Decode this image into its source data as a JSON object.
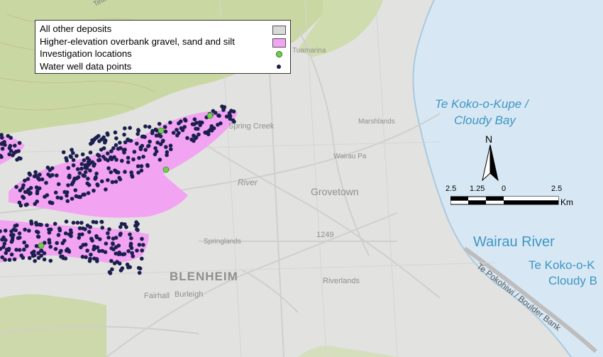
{
  "legend": {
    "items": [
      {
        "label": "All other deposits",
        "symbol": "grey-box",
        "color": "#d9d9d9"
      },
      {
        "label": "Higher-elevation overbank gravel, sand and silt",
        "symbol": "pink-box",
        "color": "#f2a3f2"
      },
      {
        "label": "Investigation locations",
        "symbol": "green-dot",
        "color": "#6fd14a"
      },
      {
        "label": "Water well data points",
        "symbol": "navy-dot",
        "color": "#1a1f4d"
      }
    ]
  },
  "map_labels": {
    "bay_name_line1": "Te Koko-o-Kupe /",
    "bay_name_line2": "Cloudy Bay",
    "river": "Wairau River",
    "bay_repeat_line1": "Te Koko-o-K",
    "bay_repeat_line2": "Cloudy B",
    "boulder_bank": "Te Pokohiwi / Boulder Bank",
    "town_main": "BLENHEIM",
    "grovetown": "Grovetown",
    "marshlands": "Marshlands",
    "springlands": "Springlands",
    "fairhall": "Fairhall",
    "burleigh": "Burleigh",
    "riverlands": "Riverlands",
    "tuamarina": "Tuamarina",
    "wairau_pa": "Wairau Pa",
    "spring_creek": "Spring Creek",
    "river_small": "River",
    "rd_number": "1249",
    "kaikohe": "Tetakakapo"
  },
  "north_arrow": {
    "label": "N"
  },
  "scale_bar": {
    "ticks": [
      "2.5",
      "1.25",
      "0",
      "2.5"
    ],
    "unit": "Km"
  },
  "colors": {
    "sea": "#d7e8f4",
    "land": "#e2e2e0",
    "hills": "#c8d6a6",
    "deposit": "#f2a3f2",
    "well": "#1a1f4d",
    "investigation": "#6fd14a",
    "water_label": "#3f95c4"
  }
}
